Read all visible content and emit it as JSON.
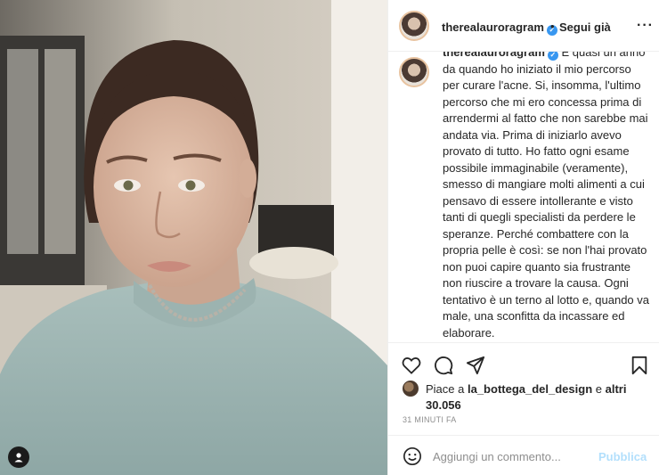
{
  "post": {
    "username": "therealauroragram",
    "follow_label": "Segui già",
    "separator": "•",
    "more_label": "···",
    "caption_text": " È quasi un anno da quando ho iniziato il mio percorso per curare l'acne. Si, insomma, l'ultimo percorso che mi ero concessa prima di arrendermi al fatto che non sarebbe mai andata via. Prima di iniziarlo avevo provato di tutto. Ho fatto ogni esame possibile immaginabile (veramente), smesso di mangiare molti alimenti a cui pensavo di essere intollerante e visto tanti di quegli specialisti da perdere le speranze. Perché combattere con la propria pelle è così: se non l'hai provato non puoi capire quanto sia frustrante non riuscire a trovare la causa. Ogni tentativo è un terno al lotto e, quando va male, una sconfitta da incassare ed elaborare.",
    "likes_prefix": "Piace a ",
    "likes_user": "la_bottega_del_design",
    "likes_middle": " e ",
    "likes_others": "altri 30.056",
    "timestamp": "31 MINUTI FA"
  },
  "comment": {
    "placeholder": "Aggiungi un commento...",
    "publish_label": "Pubblica"
  },
  "icons": [
    "heart-icon",
    "comment-icon",
    "share-icon",
    "bookmark-icon",
    "emoji-icon",
    "user-tag-icon",
    "more-options-icon",
    "verified-badge-icon"
  ],
  "colors": {
    "text": "#262626",
    "muted": "#8e8e8e",
    "verified": "#3897f0",
    "publish_disabled": "#b2dffc",
    "border": "#efefef"
  }
}
